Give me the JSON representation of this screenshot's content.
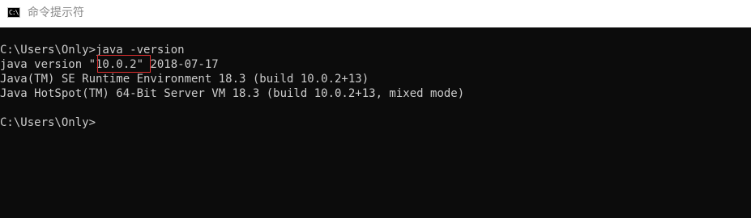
{
  "window": {
    "title": "命令提示符",
    "icon": "cmd-icon",
    "icon_glyph": "C:\\"
  },
  "console": {
    "lines": [
      "C:\\Users\\Only>java -version",
      "java version \"10.0.2\" 2018-07-17",
      "Java(TM) SE Runtime Environment 18.3 (build 10.0.2+13)",
      "Java HotSpot(TM) 64-Bit Server VM 18.3 (build 10.0.2+13, mixed mode)",
      "",
      "C:\\Users\\Only>"
    ],
    "text_color": "#cccccc",
    "background_color": "#0c0c0c"
  },
  "annotation": {
    "highlighted_text": "10.0.2",
    "color": "#e03030"
  }
}
